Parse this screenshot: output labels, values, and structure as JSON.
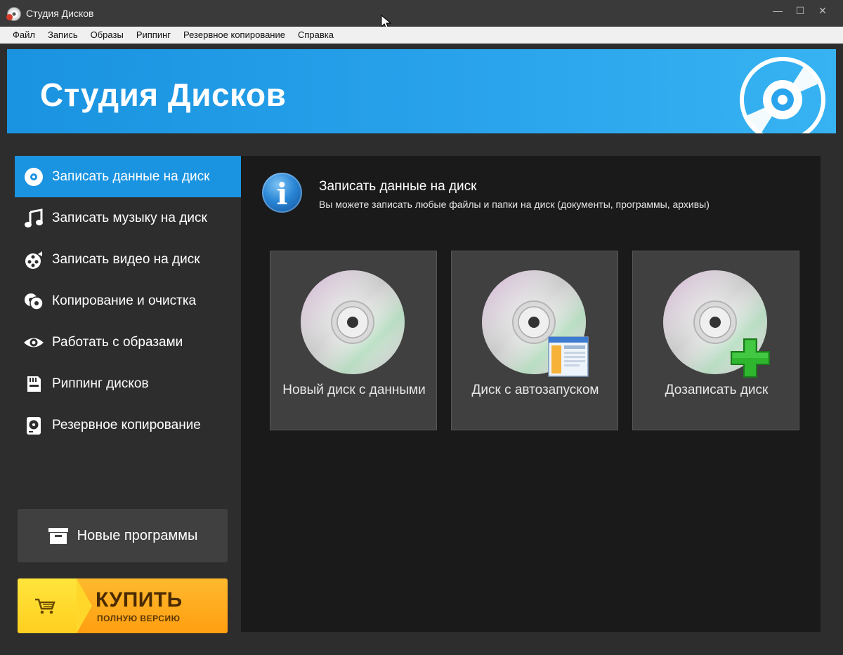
{
  "window": {
    "title": "Студия Дисков",
    "controls": {
      "minimize": "—",
      "maximize": "☐",
      "close": "✕"
    }
  },
  "menu": [
    "Файл",
    "Запись",
    "Образы",
    "Риппинг",
    "Резервное копирование",
    "Справка"
  ],
  "banner": {
    "title": "Студия Дисков",
    "icon": "disc-icon"
  },
  "sidebar": {
    "items": [
      {
        "label": "Записать данные на диск",
        "icon": "disc-data-icon",
        "active": true
      },
      {
        "label": "Записать музыку на диск",
        "icon": "music-note-icon",
        "active": false
      },
      {
        "label": "Записать видео на диск",
        "icon": "film-reel-icon",
        "active": false
      },
      {
        "label": "Копирование и очистка",
        "icon": "copy-discs-icon",
        "active": false
      },
      {
        "label": "Работать с образами",
        "icon": "eye-icon",
        "active": false
      },
      {
        "label": "Риппинг дисков",
        "icon": "sd-card-icon",
        "active": false
      },
      {
        "label": "Резервное копирование",
        "icon": "hard-drive-icon",
        "active": false
      }
    ],
    "new_programs": {
      "label": "Новые программы",
      "icon": "box-icon"
    },
    "buy": {
      "title": "КУПИТЬ",
      "subtitle": "ПОЛНУЮ ВЕРСИЮ",
      "icon": "cart-icon"
    }
  },
  "main": {
    "title": "Записать данные на диск",
    "description": "Вы можете записать любые файлы и папки на диск (документы, программы, архивы)",
    "info_icon": "i",
    "tiles": [
      {
        "label": "Новый диск с данными",
        "badge": "none"
      },
      {
        "label": "Диск с автозапуском",
        "badge": "window-icon"
      },
      {
        "label": "Дозаписать диск",
        "badge": "plus-icon"
      }
    ]
  },
  "colors": {
    "accent": "#1a93e0",
    "buy": "#ff9f10",
    "buy_left": "#ffd72a",
    "plus": "#2fb62f"
  }
}
